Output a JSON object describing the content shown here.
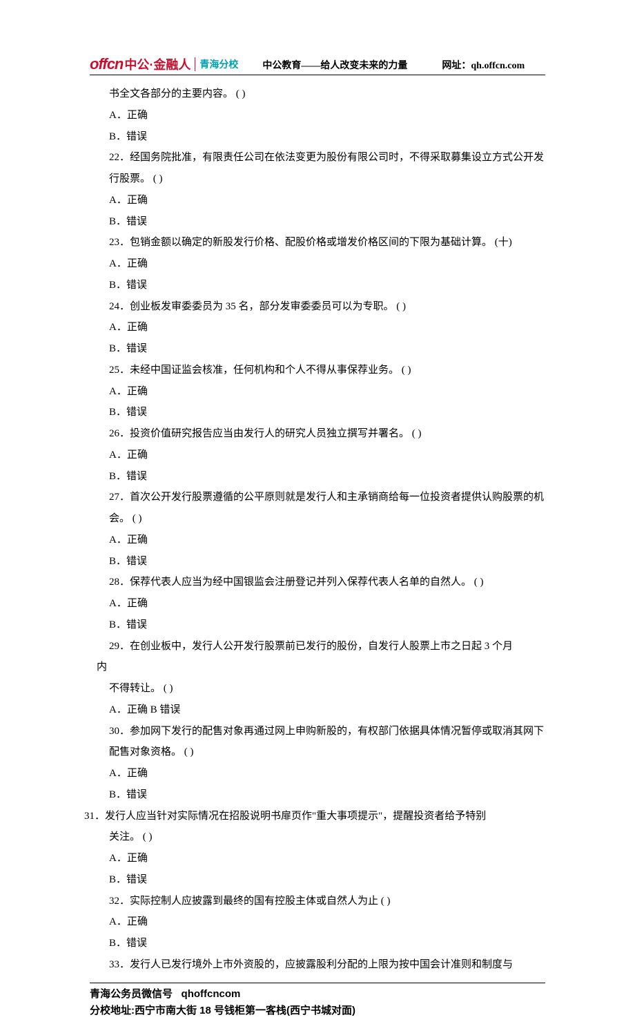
{
  "header": {
    "logo_en": "offcn",
    "logo_cn": "中公·金融人",
    "logo_branch": "青海分校",
    "slogan": "中公教育——给人改变未来的力量",
    "url_label": "网址：qh.offcn.com"
  },
  "lines": {
    "l0": "书全文各部分的主要内容。 ( )",
    "a_correct": "A．正确",
    "b_wrong": "B．错误",
    "q22": "22．经国务院批准，有限责任公司在依法变更为股份有限公司时，不得采取募集设立方式公开发行股票。 ( )",
    "q23": "23．包销金额以确定的新股发行价格、配股价格或增发价格区间的下限为基础计算。 (十)",
    "q24": "24．创业板发审委委员为 35 名，部分发审委委员可以为专职。 ( )",
    "q25": "25．未经中国证监会核准，任何机构和个人不得从事保荐业务。 ( )",
    "q26": "26．投资价值研究报告应当由发行人的研究人员独立撰写并署名。 ( )",
    "q27": "27．首次公开发行股票遵循的公平原则就是发行人和主承销商给每一位投资者提供认购股票的机会。 ( )",
    "q28": "28．保荐代表人应当为经中国银监会注册登记并列入保荐代表人名单的自然人。 ( )",
    "q29_a": "29．在创业板中，发行人公开发行股票前已发行的股份，自发行人股票上市之日起 3 个月",
    "nei": "内",
    "q29_b": "不得转让。 ( )",
    "q29_ans": "A．正确 B 错误",
    "q30": "30．参加网下发行的配售对象再通过网上申购新股的，有权部门依据具体情况暂停或取消其网下配售对象资格。 ( )",
    "q31_a": "31．发行人应当针对实际情况在招股说明书扉页作\"重大事项提示\"，提醒投资者给予特别",
    "q31_b": "关注。 ( )",
    "q32": "32．实际控制人应披露到最终的国有控股主体或自然人为止 ( )",
    "q33": "33．发行人已发行境外上市外资股的，应披露股利分配的上限为按中国会计准则和制度与"
  },
  "footer": {
    "wechat_label": "青海公务员微信号",
    "wechat_id": "qhoffcncom",
    "address": "分校地址:西宁市南大街 18 号钱柜第一客栈(西宁书城对面)"
  }
}
